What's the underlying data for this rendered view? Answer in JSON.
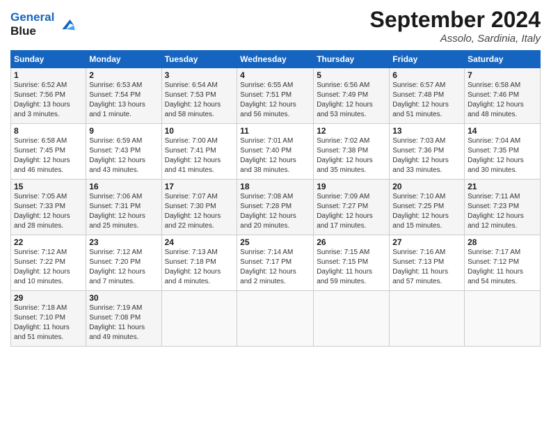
{
  "logo": {
    "line1": "General",
    "line2": "Blue"
  },
  "header": {
    "month": "September 2024",
    "location": "Assolo, Sardinia, Italy"
  },
  "weekdays": [
    "Sunday",
    "Monday",
    "Tuesday",
    "Wednesday",
    "Thursday",
    "Friday",
    "Saturday"
  ],
  "weeks": [
    [
      {
        "day": "1",
        "info": "Sunrise: 6:52 AM\nSunset: 7:56 PM\nDaylight: 13 hours\nand 3 minutes."
      },
      {
        "day": "2",
        "info": "Sunrise: 6:53 AM\nSunset: 7:54 PM\nDaylight: 13 hours\nand 1 minute."
      },
      {
        "day": "3",
        "info": "Sunrise: 6:54 AM\nSunset: 7:53 PM\nDaylight: 12 hours\nand 58 minutes."
      },
      {
        "day": "4",
        "info": "Sunrise: 6:55 AM\nSunset: 7:51 PM\nDaylight: 12 hours\nand 56 minutes."
      },
      {
        "day": "5",
        "info": "Sunrise: 6:56 AM\nSunset: 7:49 PM\nDaylight: 12 hours\nand 53 minutes."
      },
      {
        "day": "6",
        "info": "Sunrise: 6:57 AM\nSunset: 7:48 PM\nDaylight: 12 hours\nand 51 minutes."
      },
      {
        "day": "7",
        "info": "Sunrise: 6:58 AM\nSunset: 7:46 PM\nDaylight: 12 hours\nand 48 minutes."
      }
    ],
    [
      {
        "day": "8",
        "info": "Sunrise: 6:58 AM\nSunset: 7:45 PM\nDaylight: 12 hours\nand 46 minutes."
      },
      {
        "day": "9",
        "info": "Sunrise: 6:59 AM\nSunset: 7:43 PM\nDaylight: 12 hours\nand 43 minutes."
      },
      {
        "day": "10",
        "info": "Sunrise: 7:00 AM\nSunset: 7:41 PM\nDaylight: 12 hours\nand 41 minutes."
      },
      {
        "day": "11",
        "info": "Sunrise: 7:01 AM\nSunset: 7:40 PM\nDaylight: 12 hours\nand 38 minutes."
      },
      {
        "day": "12",
        "info": "Sunrise: 7:02 AM\nSunset: 7:38 PM\nDaylight: 12 hours\nand 35 minutes."
      },
      {
        "day": "13",
        "info": "Sunrise: 7:03 AM\nSunset: 7:36 PM\nDaylight: 12 hours\nand 33 minutes."
      },
      {
        "day": "14",
        "info": "Sunrise: 7:04 AM\nSunset: 7:35 PM\nDaylight: 12 hours\nand 30 minutes."
      }
    ],
    [
      {
        "day": "15",
        "info": "Sunrise: 7:05 AM\nSunset: 7:33 PM\nDaylight: 12 hours\nand 28 minutes."
      },
      {
        "day": "16",
        "info": "Sunrise: 7:06 AM\nSunset: 7:31 PM\nDaylight: 12 hours\nand 25 minutes."
      },
      {
        "day": "17",
        "info": "Sunrise: 7:07 AM\nSunset: 7:30 PM\nDaylight: 12 hours\nand 22 minutes."
      },
      {
        "day": "18",
        "info": "Sunrise: 7:08 AM\nSunset: 7:28 PM\nDaylight: 12 hours\nand 20 minutes."
      },
      {
        "day": "19",
        "info": "Sunrise: 7:09 AM\nSunset: 7:27 PM\nDaylight: 12 hours\nand 17 minutes."
      },
      {
        "day": "20",
        "info": "Sunrise: 7:10 AM\nSunset: 7:25 PM\nDaylight: 12 hours\nand 15 minutes."
      },
      {
        "day": "21",
        "info": "Sunrise: 7:11 AM\nSunset: 7:23 PM\nDaylight: 12 hours\nand 12 minutes."
      }
    ],
    [
      {
        "day": "22",
        "info": "Sunrise: 7:12 AM\nSunset: 7:22 PM\nDaylight: 12 hours\nand 10 minutes."
      },
      {
        "day": "23",
        "info": "Sunrise: 7:12 AM\nSunset: 7:20 PM\nDaylight: 12 hours\nand 7 minutes."
      },
      {
        "day": "24",
        "info": "Sunrise: 7:13 AM\nSunset: 7:18 PM\nDaylight: 12 hours\nand 4 minutes."
      },
      {
        "day": "25",
        "info": "Sunrise: 7:14 AM\nSunset: 7:17 PM\nDaylight: 12 hours\nand 2 minutes."
      },
      {
        "day": "26",
        "info": "Sunrise: 7:15 AM\nSunset: 7:15 PM\nDaylight: 11 hours\nand 59 minutes."
      },
      {
        "day": "27",
        "info": "Sunrise: 7:16 AM\nSunset: 7:13 PM\nDaylight: 11 hours\nand 57 minutes."
      },
      {
        "day": "28",
        "info": "Sunrise: 7:17 AM\nSunset: 7:12 PM\nDaylight: 11 hours\nand 54 minutes."
      }
    ],
    [
      {
        "day": "29",
        "info": "Sunrise: 7:18 AM\nSunset: 7:10 PM\nDaylight: 11 hours\nand 51 minutes."
      },
      {
        "day": "30",
        "info": "Sunrise: 7:19 AM\nSunset: 7:08 PM\nDaylight: 11 hours\nand 49 minutes."
      },
      {
        "day": "",
        "info": ""
      },
      {
        "day": "",
        "info": ""
      },
      {
        "day": "",
        "info": ""
      },
      {
        "day": "",
        "info": ""
      },
      {
        "day": "",
        "info": ""
      }
    ]
  ]
}
